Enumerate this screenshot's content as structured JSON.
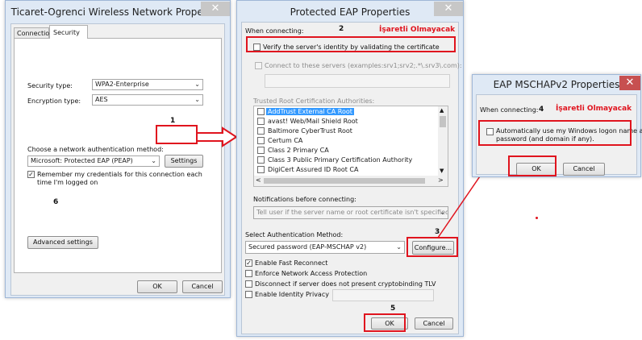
{
  "win1": {
    "title": "Ticaret-Ogrenci Wireless Network Properties",
    "tabs": [
      "Connection",
      "Security"
    ],
    "security_type_label": "Security type:",
    "security_type_value": "WPA2-Enterprise",
    "encryption_type_label": "Encryption type:",
    "encryption_type_value": "AES",
    "auth_method_label": "Choose a network authentication method:",
    "auth_method_value": "Microsoft: Protected EAP (PEAP)",
    "settings_label": "Settings",
    "remember_line1": "Remember my credentials for this connection each",
    "remember_line2": "time I'm logged on",
    "advanced_label": "Advanced settings",
    "ok_label": "OK",
    "cancel_label": "Cancel"
  },
  "win2": {
    "title": "Protected EAP Properties",
    "when_connecting": "When connecting:",
    "verify_label": "Verify the server's identity by validating the certificate",
    "connect_servers_label": "Connect to these servers (examples:srv1;srv2;.*\\.srv3\\.com):",
    "trusted_root_label": "Trusted Root Certification Authorities:",
    "ca_list": [
      "AddTrust External CA Root",
      "avast! Web/Mail Shield Root",
      "Baltimore CyberTrust Root",
      "Certum CA",
      "Class 2 Primary CA",
      "Class 3 Public Primary Certification Authority",
      "DigiCert Assured ID Root CA"
    ],
    "notifications_label": "Notifications before connecting:",
    "notifications_value": "Tell user if the server name or root certificate isn't specified",
    "select_auth_label": "Select Authentication Method:",
    "auth_value": "Secured password (EAP-MSCHAP v2)",
    "configure_label": "Configure...",
    "fast_reconnect": "Enable Fast Reconnect",
    "nap": "Enforce Network Access Protection",
    "disconnect_tlv": "Disconnect if server does not present cryptobinding TLV",
    "identity_privacy": "Enable Identity Privacy",
    "ok_label": "OK",
    "cancel_label": "Cancel"
  },
  "win3": {
    "title": "EAP MSCHAPv2 Properties",
    "when_connecting": "When connecting:",
    "auto_line1": "Automatically use my Windows logon name and",
    "auto_line2": "password (and domain if any).",
    "ok_label": "OK",
    "cancel_label": "Cancel"
  },
  "annotations": {
    "n1": "1",
    "n2": "2",
    "n3": "3",
    "n4": "4",
    "n5": "5",
    "n6": "6",
    "not_checked_2": "İşaretli Olmayacak",
    "not_checked_4": "İşaretli Olmayacak"
  },
  "colors": {
    "annotation_red": "#e0141e",
    "selection_blue": "#3399ff"
  },
  "icons": {
    "close": "close-icon",
    "dropdown": "chevron-down-icon",
    "check": "check-icon"
  }
}
